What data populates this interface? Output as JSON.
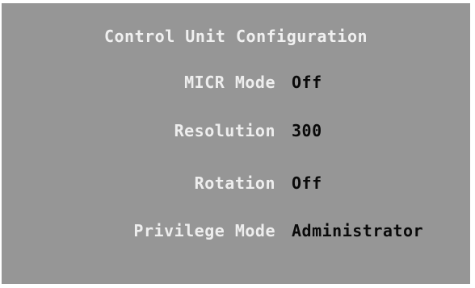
{
  "panel": {
    "title": "Control Unit Configuration",
    "rows": [
      {
        "label": "MICR Mode",
        "value": "Off"
      },
      {
        "label": "Resolution",
        "value": "300"
      },
      {
        "label": "Rotation",
        "value": "Off"
      },
      {
        "label": "Privilege Mode",
        "value": "Administrator"
      }
    ]
  },
  "colors": {
    "panel_background": "#969696",
    "label_text": "#eeeeee",
    "value_text": "#0a0a0a"
  }
}
